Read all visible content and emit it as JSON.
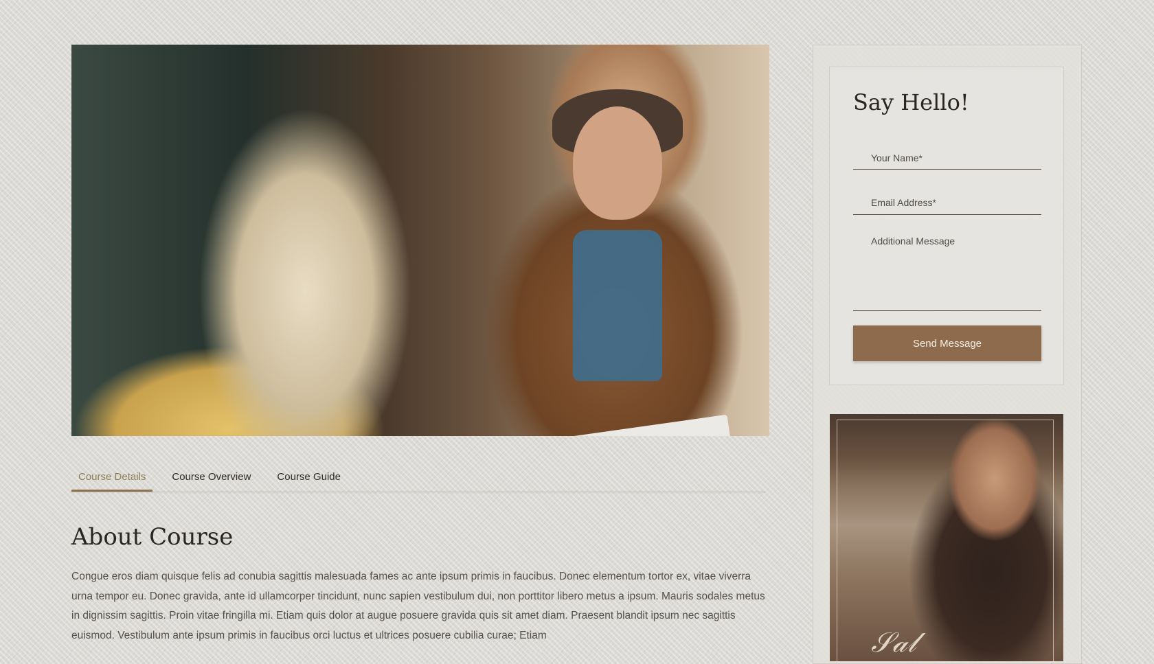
{
  "tabs": [
    {
      "label": "Course Details"
    },
    {
      "label": "Course Overview"
    },
    {
      "label": "Course Guide"
    }
  ],
  "about": {
    "title": "About Course",
    "text": "Congue eros diam quisque felis ad conubia sagittis malesuada fames ac ante ipsum primis in faucibus. Donec elementum tortor ex, vitae viverra urna tempor eu. Donec gravida, ante id ullamcorper tincidunt, nunc sapien vestibulum dui, non porttitor libero metus a ipsum. Mauris sodales metus in dignissim sagittis. Proin vitae fringilla mi. Etiam quis dolor at augue posuere gravida quis sit amet diam. Praesent blandit ipsum nec sagittis euismod. Vestibulum ante ipsum primis in faucibus orci luctus et ultrices posuere cubilia curae; Etiam"
  },
  "contact_form": {
    "title": "Say Hello!",
    "name_placeholder": "Your Name*",
    "email_placeholder": "Email Address*",
    "message_placeholder": "Additional Message",
    "submit_label": "Send Message"
  },
  "colors": {
    "accent": "#8e6b4d",
    "active_tab_text": "#8a7f54"
  },
  "icons": []
}
